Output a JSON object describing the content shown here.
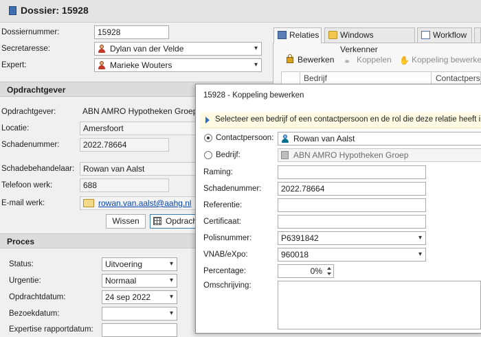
{
  "title": "Dossier: 15928",
  "form": {
    "dossiernummer_label": "Dossiernummer:",
    "dossiernummer": "15928",
    "secretaresse_label": "Secretaresse:",
    "secretaresse": "Dylan van der Velde",
    "expert_label": "Expert:",
    "expert": "Marieke Wouters"
  },
  "opdrachtgever": {
    "section": "Opdrachtgever",
    "opdrachtgever_label": "Opdrachtgever:",
    "opdrachtgever": "ABN AMRO Hypotheken Groep",
    "locatie_label": "Locatie:",
    "locatie": "Amersfoort",
    "schadenummer_label": "Schadenummer:",
    "schadenummer": "2022.78664",
    "behandelaar_label": "Schadebehandelaar:",
    "behandelaar": "Rowan van Aalst",
    "telefoon_label": "Telefoon werk:",
    "telefoon": "688",
    "email_label": "E-mail werk:",
    "email": "rowan.van.aalst@aahg.nl",
    "wissen": "Wissen",
    "opdracht": "Opdrach"
  },
  "proces": {
    "section": "Proces",
    "status_label": "Status:",
    "status": "Uitvoering",
    "urgentie_label": "Urgentie:",
    "urgentie": "Normaal",
    "opdrachtdatum_label": "Opdrachtdatum:",
    "opdrachtdatum": "24 sep 2022",
    "bezoekdatum_label": "Bezoekdatum:",
    "bezoekdatum": "",
    "expertise_label": "Expertise rapportdatum:"
  },
  "tabs": {
    "relaties": "Relaties",
    "windows": "Windows Verkenner",
    "workflow": "Workflow"
  },
  "toolbar": {
    "bewerken": "Bewerken",
    "koppelen": "Koppelen",
    "koppeling_bewerken": "Koppeling bewerke"
  },
  "grid": {
    "col_bedrijf": "Bedrijf",
    "col_contact": "Contactpers"
  },
  "dialog": {
    "title": "15928 - Koppeling bewerken",
    "info": "Selecteer een bedrijf of een contactpersoon en de rol die deze relatie heeft in",
    "contactpersoon_label": "Contactpersoon:",
    "contactpersoon": "Rowan van Aalst",
    "bedrijf_label": "Bedrijf:",
    "bedrijf": "ABN AMRO Hypotheken Groep",
    "raming_label": "Raming:",
    "raming": "",
    "schadenummer_label": "Schadenummer:",
    "schadenummer": "2022.78664",
    "referentie_label": "Referentie:",
    "referentie": "",
    "certificaat_label": "Certificaat:",
    "certificaat": "",
    "polisnummer_label": "Polisnummer:",
    "polisnummer": "P6391842",
    "vnab_label": "VNAB/eXpo:",
    "vnab": "960018",
    "percentage_label": "Percentage:",
    "percentage": "0%",
    "omschrijving_label": "Omschrijving:"
  }
}
